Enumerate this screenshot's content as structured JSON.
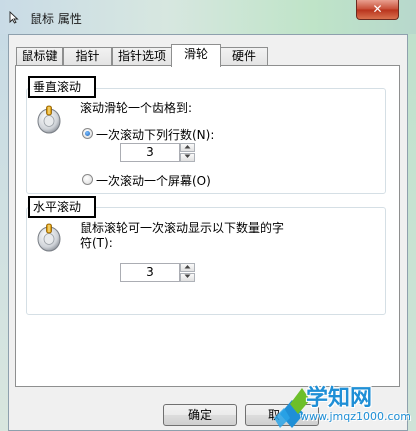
{
  "window": {
    "title": "鼠标 属性",
    "close_glyph": "✕"
  },
  "tabs": [
    {
      "label": "鼠标键",
      "active": false
    },
    {
      "label": "指针",
      "active": false
    },
    {
      "label": "指针选项",
      "active": false
    },
    {
      "label": "滑轮",
      "active": true
    },
    {
      "label": "硬件",
      "active": false
    }
  ],
  "vertical_scroll": {
    "group_title": "垂直滚动",
    "description": "滚动滑轮一个齿格到:",
    "option_lines": "一次滚动下列行数(N):",
    "lines_value": "3",
    "option_screen": "一次滚动一个屏幕(O)",
    "selected": "option_lines"
  },
  "horizontal_scroll": {
    "group_title": "水平滚动",
    "description_line1": "鼠标滚轮可一次滚动显示以下数量的字",
    "description_line2": "符(T):",
    "chars_value": "3"
  },
  "buttons": {
    "ok": "确定",
    "cancel": "取"
  },
  "watermark": {
    "site_name": "学知网",
    "url": "www.jmqz1000.com"
  },
  "icons": {
    "title": "mouse-pointer-icon",
    "wheel": "mouse-wheel-icon",
    "spin_up": "chevron-up-icon",
    "spin_down": "chevron-down-icon"
  },
  "colors": {
    "close_button": "#c64b34",
    "radio_checked": "#1660b8",
    "watermark_text": "#1f8fd6",
    "watermark_logo_green": "#6cbf2a"
  }
}
